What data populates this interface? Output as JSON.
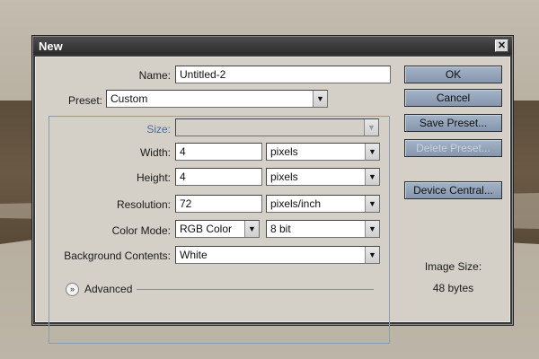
{
  "dialog": {
    "title": "New",
    "close_glyph": "✕"
  },
  "form": {
    "name_label": "Name:",
    "name_value": "Untitled-2",
    "preset_label": "Preset:",
    "preset_value": "Custom",
    "size_label": "Size:",
    "size_value": "",
    "width_label": "Width:",
    "width_value": "4",
    "width_unit": "pixels",
    "height_label": "Height:",
    "height_value": "4",
    "height_unit": "pixels",
    "resolution_label": "Resolution:",
    "resolution_value": "72",
    "resolution_unit": "pixels/inch",
    "color_mode_label": "Color Mode:",
    "color_mode_value": "RGB Color",
    "bit_depth_value": "8 bit",
    "bg_contents_label": "Background Contents:",
    "bg_contents_value": "White",
    "advanced_label": "Advanced"
  },
  "buttons": {
    "ok": "OK",
    "cancel": "Cancel",
    "save_preset": "Save Preset...",
    "delete_preset": "Delete Preset...",
    "device_central": "Device Central..."
  },
  "info": {
    "image_size_label": "Image Size:",
    "image_size_value": "48 bytes"
  },
  "icons": {
    "dropdown": "chevron-down-icon",
    "advanced": "double-chevron-down-icon",
    "close": "close-icon"
  },
  "colors": {
    "button_blue": "#8596ad",
    "dialog_bg": "#d4d0c8",
    "titlebar": "#3a3a3a",
    "disabled_label": "#4a6b95"
  }
}
